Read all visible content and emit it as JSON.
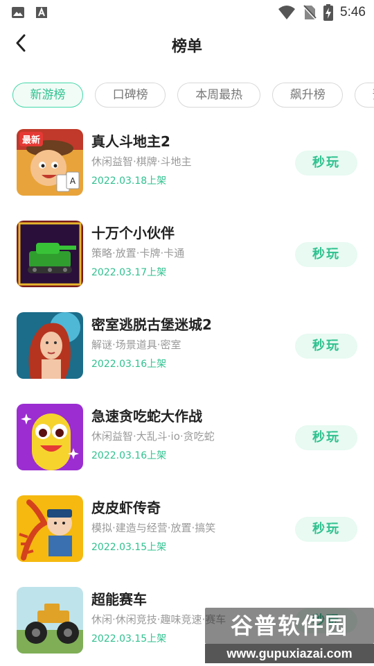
{
  "status_bar": {
    "time": "5:46",
    "left_icons": [
      "image-icon",
      "font-icon"
    ],
    "right_icons": [
      "wifi-icon",
      "no-sim-icon",
      "battery-charging-icon"
    ]
  },
  "header": {
    "title": "榜单",
    "back_icon": "chevron-left-icon"
  },
  "tabs": [
    {
      "label": "新游榜",
      "active": true
    },
    {
      "label": "口碑榜",
      "active": false
    },
    {
      "label": "本周最热",
      "active": false
    },
    {
      "label": "飙升榜",
      "active": false
    },
    {
      "label": "预约榜",
      "active": false
    }
  ],
  "games": [
    {
      "name": "真人斗地主2",
      "tags": "休闲益智·棋牌·斗地主",
      "date": "2022.03.18上架",
      "action": "秒玩",
      "thumb_badge": "最新"
    },
    {
      "name": "十万个小伙伴",
      "tags": "策略·放置·卡牌·卡通",
      "date": "2022.03.17上架",
      "action": "秒玩"
    },
    {
      "name": "密室逃脱古堡迷城2",
      "tags": "解谜·场景道具·密室",
      "date": "2022.03.16上架",
      "action": "秒玩"
    },
    {
      "name": "急速贪吃蛇大作战",
      "tags": "休闲益智·大乱斗·io·贪吃蛇",
      "date": "2022.03.16上架",
      "action": "秒玩"
    },
    {
      "name": "皮皮虾传奇",
      "tags": "模拟·建造与经营·放置·搞笑",
      "date": "2022.03.15上架",
      "action": "秒玩"
    },
    {
      "name": "超能赛车",
      "tags": "休闲·休闲竞技·趣味竞速·赛车",
      "date": "2022.03.15上架",
      "action": "秒玩"
    }
  ],
  "watermark": {
    "title": "谷普软件园",
    "url": "www.gupuxiazai.com"
  },
  "colors": {
    "accent": "#2fc18f",
    "accent_bg": "#e8faf2"
  }
}
